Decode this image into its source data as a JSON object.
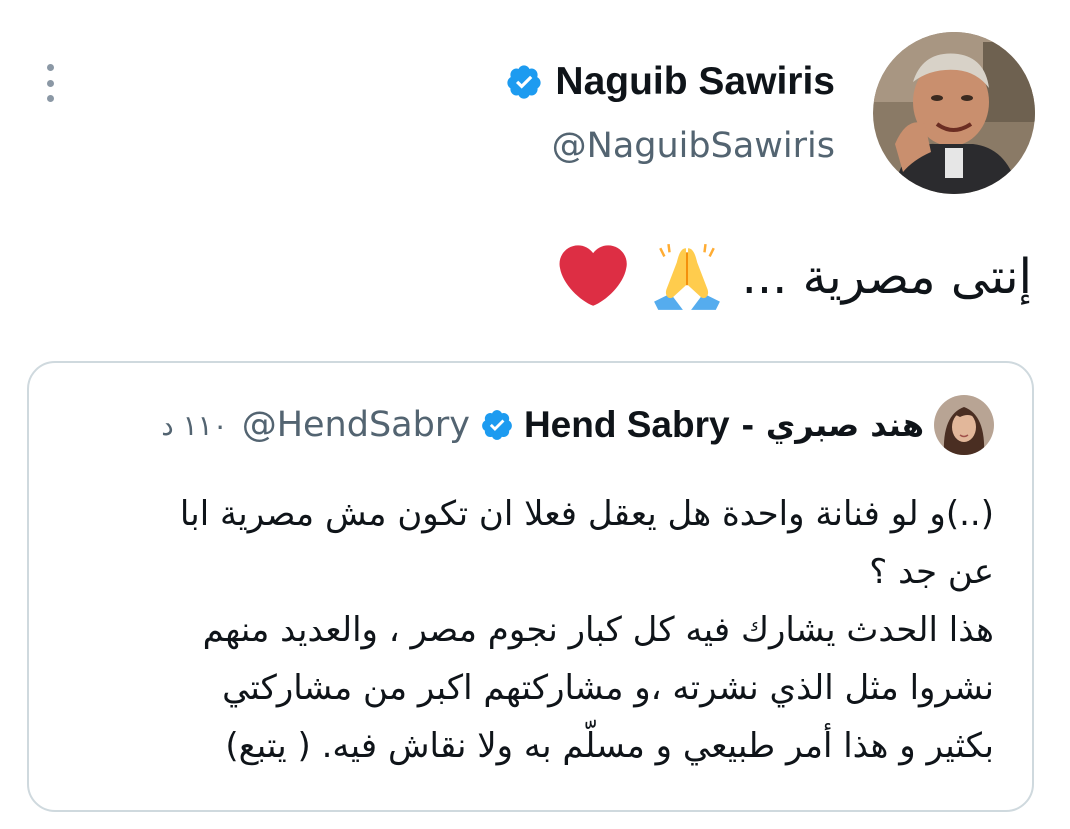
{
  "tweet": {
    "author": {
      "display_name": "Naguib Sawiris",
      "handle": "@NaguibSawiris",
      "verified": true,
      "avatar_icon": "profile-photo"
    },
    "more_menu_icon": "more-vertical-icon",
    "text": "إنتى مصرية ...",
    "emojis": [
      "folded-hands-emoji",
      "red-heart-emoji"
    ]
  },
  "quoted_tweet": {
    "author": {
      "display_name_ar": "هند صبري",
      "separator": "-",
      "display_name_en": "Hend Sabry",
      "handle": "@HendSabry",
      "verified": true,
      "avatar_icon": "profile-photo"
    },
    "timestamp": "١١٠ د",
    "lines": [
      "(..)و لو فنانة واحدة هل يعقل فعلا ان تكون مش مصرية ابا",
      "عن جد ؟",
      "هذا الحدث يشارك فيه كل كبار نجوم مصر ، والعديد منهم",
      "نشروا مثل الذي نشرته ،و مشاركتهم اكبر من مشاركتي",
      "بكثير و هذا أمر طبيعي و مسلّم به ولا نقاش فيه. ( يتبع)"
    ]
  },
  "colors": {
    "text_primary": "#0f1419",
    "text_secondary": "#536471",
    "verified_blue": "#1d9bf0",
    "card_border": "#cfd9de",
    "heart_red": "#dd2e44"
  }
}
